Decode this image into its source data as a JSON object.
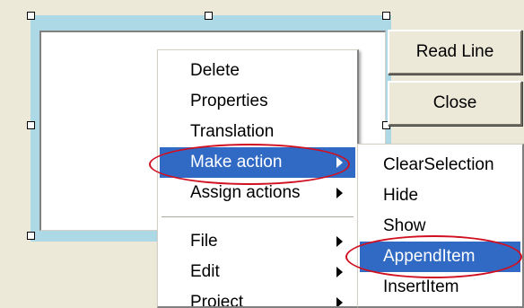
{
  "buttons": {
    "read_line": "Read Line",
    "close": "Close"
  },
  "context_menu": {
    "items": [
      {
        "label": "Delete"
      },
      {
        "label": "Properties"
      },
      {
        "label": "Translation"
      },
      {
        "label": "Make action",
        "submenu": true,
        "selected": true,
        "circled": true
      },
      {
        "label": "Assign actions",
        "submenu": true
      },
      {
        "label": "File",
        "submenu": true
      },
      {
        "label": "Edit",
        "submenu": true
      },
      {
        "label": "Project",
        "submenu": true
      }
    ]
  },
  "action_submenu": {
    "items": [
      {
        "label": "ClearSelection"
      },
      {
        "label": "Hide"
      },
      {
        "label": "Show"
      },
      {
        "label": "AppendItem",
        "selected": true,
        "circled": true
      },
      {
        "label": "InsertItem"
      }
    ]
  },
  "colors": {
    "selection_highlight": "#316ac5",
    "annotation_oval": "#d01020",
    "selected_frame": "#add8e6",
    "window_background": "#ece9d8"
  }
}
